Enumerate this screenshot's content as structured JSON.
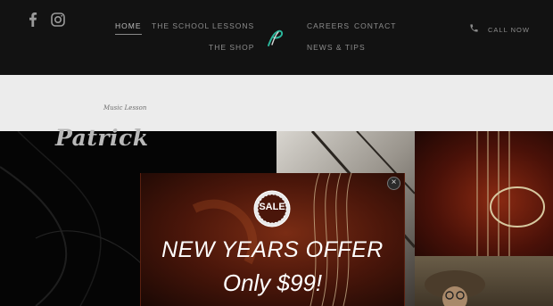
{
  "social": {
    "facebook_icon": "facebook-icon",
    "instagram_icon": "instagram-icon"
  },
  "nav": {
    "home": "HOME",
    "the_school": "THE SCHOOL",
    "lessons": "LESSONS",
    "the_shop": "THE SHOP",
    "careers": "CAREERS",
    "contact": "CONTACT",
    "news_tips": "NEWS & TIPS"
  },
  "header": {
    "call_label": "CALL NOW",
    "phone_icon": "phone-icon"
  },
  "gallery": {
    "caption": "Music Lesson",
    "name": "Patrick"
  },
  "popup": {
    "badge": "SALE",
    "title": "NEW YEARS OFFER",
    "price": "Only $99!",
    "close": "×"
  },
  "colors": {
    "header_bg": "#121212",
    "nav_text": "#8c8c8c",
    "popup_bg": "#4a160a",
    "accent_logo": "#2bb69b"
  }
}
